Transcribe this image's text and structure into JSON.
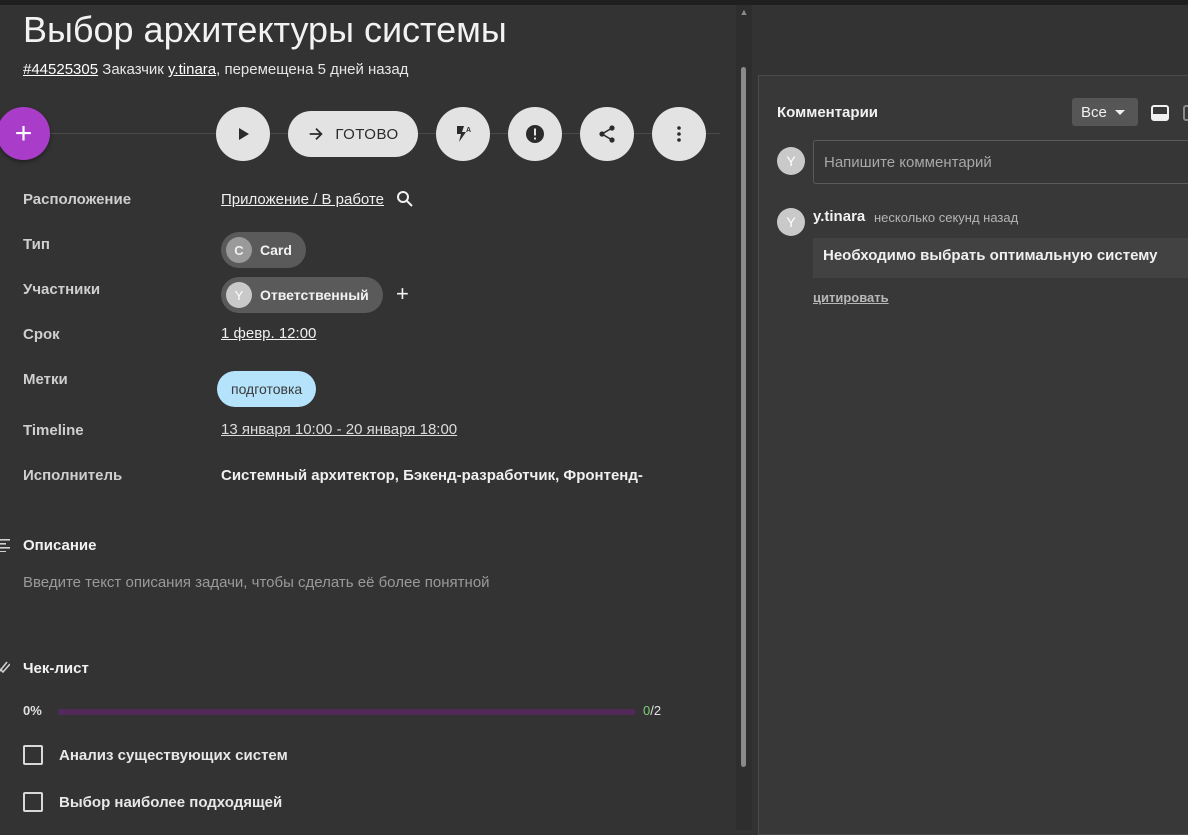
{
  "task": {
    "title": "Выбор архитектуры системы",
    "id": "#44525305",
    "customer_prefix": "Заказчик",
    "customer": "y.tinara",
    "moved_text": ", перемещена 5 дней назад"
  },
  "actions": {
    "add_label": "+",
    "done_label": "ГОТОВО"
  },
  "fields": {
    "location": {
      "label": "Расположение",
      "value": "Приложение / В работе"
    },
    "type": {
      "label": "Тип",
      "chip_initial": "C",
      "value": "Card"
    },
    "participants": {
      "label": "Участники",
      "chip_initial": "Y",
      "value": "Ответственный",
      "add_label": "+"
    },
    "deadline": {
      "label": "Срок",
      "value": "1 февр. 12:00"
    },
    "tags": {
      "label": "Метки",
      "value": "подготовка"
    },
    "timeline": {
      "label": "Timeline",
      "value": "13 января 10:00 - 20 января 18:00"
    },
    "assignee": {
      "label": "Исполнитель",
      "value": "Системный архитектор, Бэкенд-разработчик, Фронтенд-р"
    }
  },
  "description": {
    "title": "Описание",
    "placeholder": "Введите текст описания задачи, чтобы сделать её более понятной"
  },
  "checklist": {
    "title": "Чек-лист",
    "percent_label": "0%",
    "progress_fraction": 0,
    "done_count": "0",
    "total_label": "/2",
    "items": [
      {
        "label": "Анализ существующих систем",
        "checked": false
      },
      {
        "label": "Выбор наиболее подходящей",
        "checked": false
      }
    ]
  },
  "comments": {
    "title": "Комментарии",
    "filter_value": "Все",
    "current_user_initial": "Y",
    "input_placeholder": "Напишите комментарий",
    "list": [
      {
        "author_initial": "Y",
        "author": "y.tinara",
        "time": "несколько секунд назад",
        "text": "Необходимо выбрать оптимальную систему",
        "quote_label": "цитировать"
      }
    ]
  },
  "colors": {
    "accent": "#a93cc8",
    "background": "#333333",
    "tag": "#b5e3fb",
    "progress_done": "#7bcf71"
  }
}
